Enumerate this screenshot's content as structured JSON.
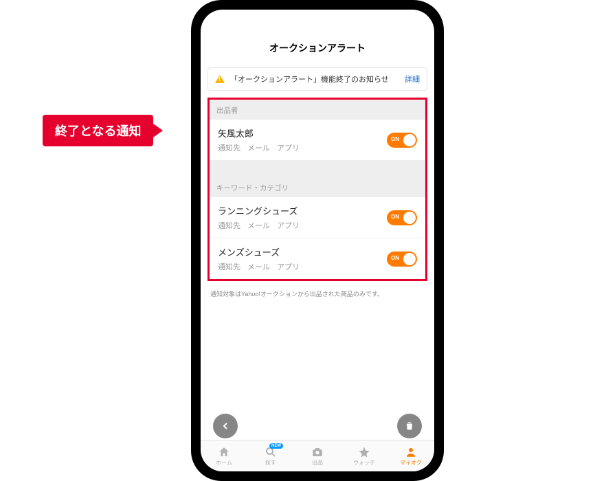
{
  "callout": "終了となる通知",
  "header": {
    "title": "オークションアラート"
  },
  "notice": {
    "text": "「オークションアラート」機能終了のお知らせ",
    "link": "詳細"
  },
  "sections": {
    "seller": {
      "label": "出品者",
      "items": [
        {
          "title": "矢風太郎",
          "sub_label": "通知先",
          "sub_mail": "メール",
          "sub_app": "アプリ",
          "toggle": "ON"
        }
      ]
    },
    "keyword": {
      "label": "キーワード・カテゴリ",
      "items": [
        {
          "title": "ランニングシューズ",
          "sub_label": "通知先",
          "sub_mail": "メール",
          "sub_app": "アプリ",
          "toggle": "ON"
        },
        {
          "title": "メンズシューズ",
          "sub_label": "通知先",
          "sub_mail": "メール",
          "sub_app": "アプリ",
          "toggle": "ON"
        }
      ]
    }
  },
  "footnote": "通知対象はYahoo!オークションから出品された商品のみです。",
  "tabs": {
    "home": "ホーム",
    "search": "探す",
    "search_badge": "NEW",
    "sell": "出品",
    "watch": "ウォッチ",
    "myauc": "マイオク"
  }
}
